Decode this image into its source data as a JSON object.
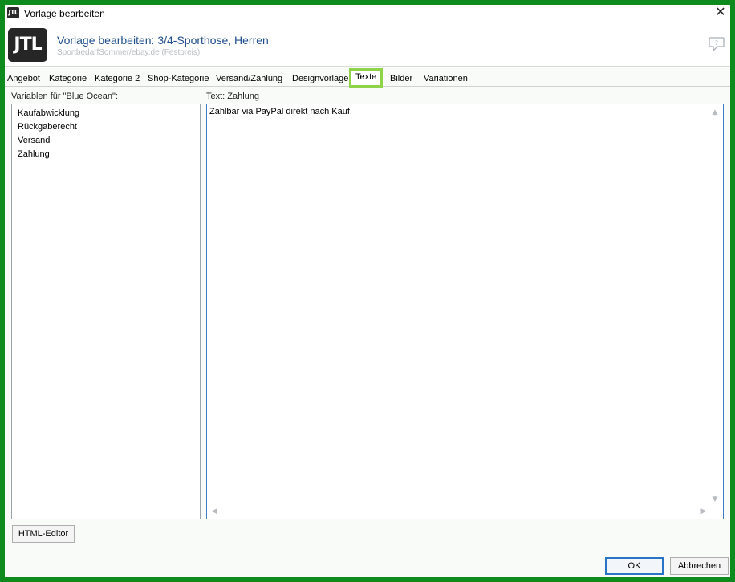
{
  "window": {
    "title": "Vorlage bearbeiten",
    "title_logo": "JTL",
    "close_glyph": "✕"
  },
  "header": {
    "logo": "JTL",
    "title": "Vorlage bearbeiten: 3/4-Sporthose, Herren",
    "subtitle": "SportbedarfSommer/ebay.de (Festpreis)",
    "help_icon": "speech-bubble-help-icon"
  },
  "tabs": [
    {
      "label": "Angebot"
    },
    {
      "label": "Kategorie"
    },
    {
      "label": "Kategorie 2"
    },
    {
      "label": "Shop-Kategorie"
    },
    {
      "label": "Versand/Zahlung"
    },
    {
      "label": "Designvorlage"
    },
    {
      "label": "Texte",
      "active": true
    },
    {
      "label": "Bilder"
    },
    {
      "label": "Variationen"
    }
  ],
  "variables": {
    "label": "Variablen für \"Blue Ocean\":",
    "items": [
      "Kaufabwicklung",
      "Rückgaberecht",
      "Versand",
      "Zahlung"
    ]
  },
  "text_editor": {
    "label": "Text: Zahlung",
    "content": "Zahlbar via PayPal direkt nach Kauf."
  },
  "buttons": {
    "html_editor": "HTML-Editor",
    "ok": "OK",
    "cancel": "Abbrechen"
  },
  "colors": {
    "frame_highlight": "#0f8a1c",
    "active_tab_highlight": "#8ed349",
    "header_title": "#1f4e8c",
    "focus_border": "#3c7dc4"
  }
}
